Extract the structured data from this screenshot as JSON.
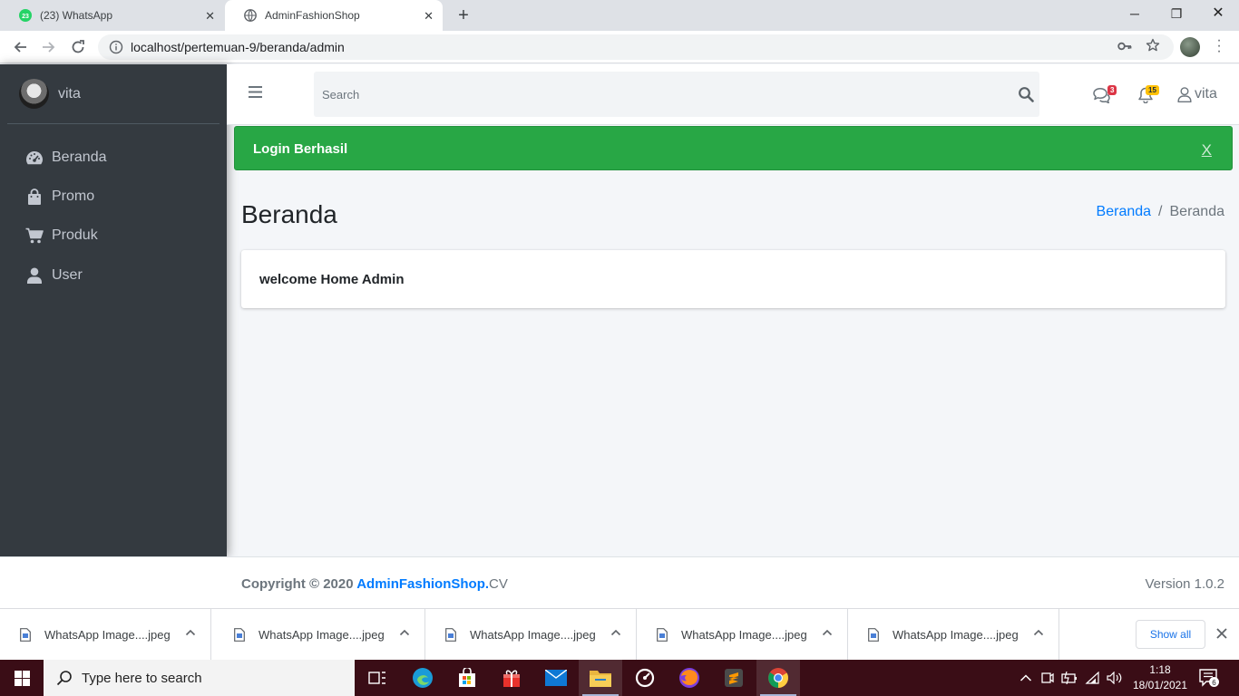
{
  "browser": {
    "tabs": [
      {
        "title": "(23) WhatsApp",
        "badge": "23"
      },
      {
        "title": "AdminFashionShop"
      }
    ],
    "url": "localhost/pertemuan-9/beranda/admin"
  },
  "sidebar": {
    "user_name": "vita",
    "items": [
      {
        "label": "Beranda",
        "icon": "tachometer-icon"
      },
      {
        "label": "Promo",
        "icon": "shopping-bag-icon"
      },
      {
        "label": "Produk",
        "icon": "cart-icon"
      },
      {
        "label": "User",
        "icon": "user-icon"
      }
    ]
  },
  "navbar": {
    "search_placeholder": "Search",
    "messages_count": "3",
    "notifications_count": "15",
    "user_name": "vita"
  },
  "alert": {
    "message": "Login Berhasil",
    "close_label": "X",
    "color": "#28a745"
  },
  "page": {
    "title": "Beranda",
    "breadcrumb": [
      "Beranda",
      "Beranda"
    ],
    "card_text": "welcome Home Admin"
  },
  "footer": {
    "copyright_prefix": "Copyright © 2020",
    "brand": "AdminFashionShop.",
    "suffix": "CV",
    "version": "Version 1.0.2"
  },
  "downloads": {
    "files": [
      "WhatsApp Image....jpeg",
      "WhatsApp Image....jpeg",
      "WhatsApp Image....jpeg",
      "WhatsApp Image....jpeg",
      "WhatsApp Image....jpeg"
    ],
    "show_all_label": "Show all"
  },
  "taskbar": {
    "search_placeholder": "Type here to search",
    "time": "1:18",
    "date": "18/01/2021",
    "notification_count": "6"
  },
  "colors": {
    "sidebar_bg": "#343a40",
    "primary": "#007bff",
    "success": "#28a745",
    "badge_danger": "#dc3545",
    "badge_warning": "#ffc107"
  }
}
